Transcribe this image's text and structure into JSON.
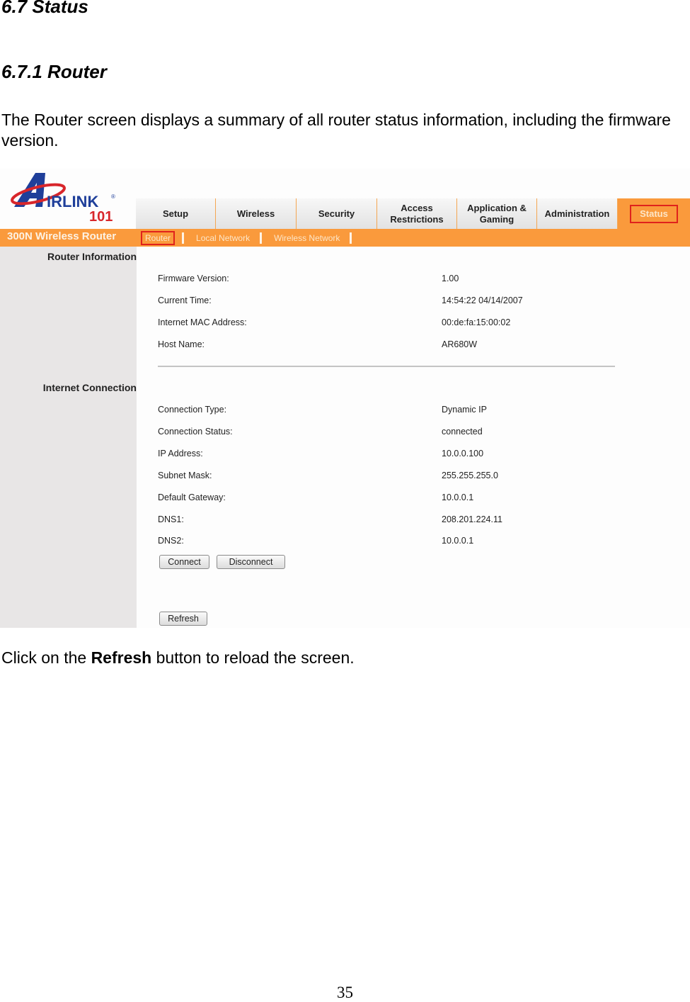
{
  "doc": {
    "heading_1": "6.7 Status",
    "heading_2": "6.7.1 Router",
    "intro": "The Router screen displays a summary of all router status information, including the firmware version.",
    "outro_before": "Click on the ",
    "outro_bold": "Refresh",
    "outro_after": " button to reload the screen.",
    "page_number": "35"
  },
  "router_ui": {
    "logo": {
      "brand": "AIRLINK",
      "number": "101",
      "icon": "airlink101-logo"
    },
    "product_name": "300N Wireless Router",
    "tabs": [
      {
        "label": "Setup",
        "active": false
      },
      {
        "label": "Wireless",
        "active": false
      },
      {
        "label": "Security",
        "active": false
      },
      {
        "label": "Access Restrictions",
        "active": false
      },
      {
        "label": "Application & Gaming",
        "active": false
      },
      {
        "label": "Administration",
        "active": false
      },
      {
        "label": "Status",
        "active": true
      }
    ],
    "subtabs": [
      {
        "label": "Router",
        "active": true
      },
      {
        "label": "Local Network",
        "active": false
      },
      {
        "label": "Wireless Network",
        "active": false
      }
    ],
    "sections": {
      "router_information": {
        "title": "Router Information",
        "rows": [
          {
            "label": "Firmware Version:",
            "value": "1.00"
          },
          {
            "label": "Current Time:",
            "value": "14:54:22 04/14/2007"
          },
          {
            "label": "Internet MAC Address:",
            "value": "00:de:fa:15:00:02"
          },
          {
            "label": "Host Name:",
            "value": "AR680W"
          }
        ]
      },
      "internet_connection": {
        "title": "Internet Connection",
        "rows": [
          {
            "label": "Connection Type:",
            "value": "Dynamic IP"
          },
          {
            "label": "Connection Status:",
            "value": "connected"
          },
          {
            "label": "IP Address:",
            "value": "10.0.0.100"
          },
          {
            "label": "Subnet Mask:",
            "value": "255.255.255.0"
          },
          {
            "label": "Default Gateway:",
            "value": "10.0.0.1"
          },
          {
            "label": "DNS1:",
            "value": "208.201.224.11"
          },
          {
            "label": "DNS2:",
            "value": "10.0.0.1"
          }
        ]
      }
    },
    "buttons": {
      "connect": "Connect",
      "disconnect": "Disconnect",
      "refresh": "Refresh"
    },
    "colors": {
      "accent_orange": "#fa9a3c",
      "highlight_red": "#e0221c",
      "sidebar_gray": "#e8e6e6"
    }
  }
}
